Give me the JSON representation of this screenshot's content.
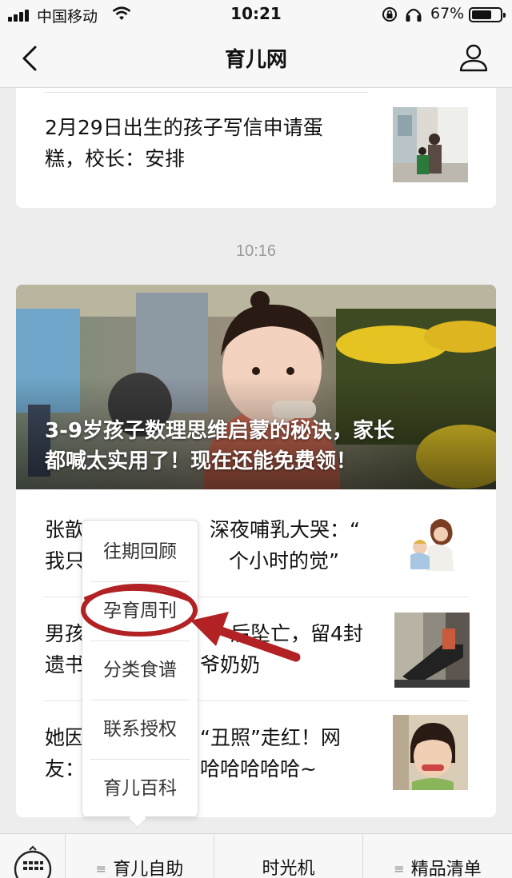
{
  "status_bar": {
    "carrier": "中国移动",
    "time": "10:21",
    "battery": "67%",
    "battery_level": 0.67
  },
  "nav": {
    "title": "育儿网",
    "back_icon": "chevron-left-icon",
    "profile_icon": "person-icon"
  },
  "feed": {
    "article_1": {
      "title_line1": "2月29日出生的孩子写信申请蛋",
      "title_line2": "糕，校长：安排"
    },
    "timestamp": "10:16",
    "hero": {
      "title_line1": "3-9岁孩子数理思维启蒙的秘诀，家长",
      "title_line2": "都喊太实用了！现在还能免费领！"
    },
    "article_2": {
      "title_line1_a": "张歆",
      "title_line1_b": "深夜哺乳大哭：“",
      "title_line2_a": "我只",
      "title_line2_b": "个小时的觉”"
    },
    "article_3": {
      "title_line1_a": "男孩",
      "title_line1_b": "后坠亡，留4封",
      "title_line2_a": "遗书",
      "title_line2_b": "爷奶奶"
    },
    "article_4": {
      "title_line1_a": "她因",
      "title_line1_b": "“丑照”走红！网",
      "title_line2_a": "友：",
      "title_line2_b": "哈哈哈哈哈~"
    }
  },
  "popup_menu": {
    "items": [
      "往期回顾",
      "孕育周刊",
      "分类食谱",
      "联系授权",
      "育儿百科"
    ],
    "highlighted": "孕育周刊",
    "highlight_color": "#b22225"
  },
  "bottom_menu": {
    "keyboard_icon": "keyboard-icon",
    "tabs": [
      "育儿自助",
      "时光机",
      "精品清单"
    ]
  }
}
